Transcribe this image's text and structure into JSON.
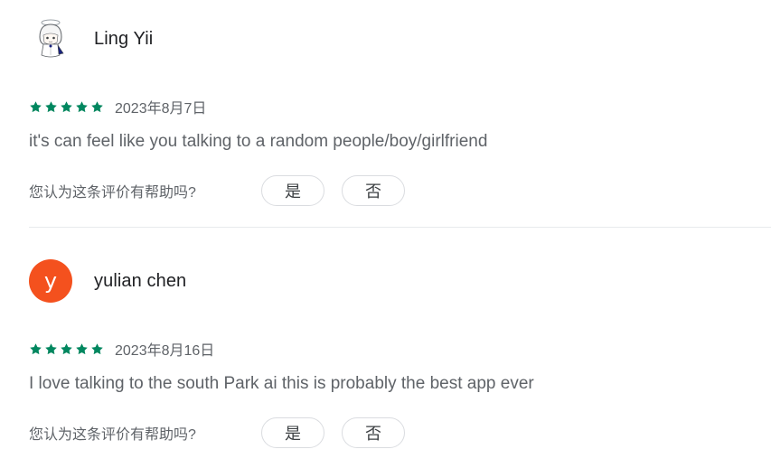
{
  "colors": {
    "star": "#01875f",
    "avatar_letter_bg": "#f4511e",
    "text_primary": "#202124",
    "text_secondary": "#5f6368"
  },
  "reviews": [
    {
      "author": "Ling Yii",
      "avatar_type": "image",
      "rating": 5,
      "date": "2023年8月7日",
      "text": "it's can feel like you talking to a random people/boy/girlfriend",
      "helpful_question": "您认为这条评价有帮助吗?",
      "yes_label": "是",
      "no_label": "否"
    },
    {
      "author": "yulian chen",
      "avatar_type": "letter",
      "avatar_letter": "y",
      "rating": 5,
      "date": "2023年8月16日",
      "text": "I love talking to the south Park ai this is probably the best app ever",
      "helpful_question": "您认为这条评价有帮助吗?",
      "yes_label": "是",
      "no_label": "否"
    }
  ]
}
